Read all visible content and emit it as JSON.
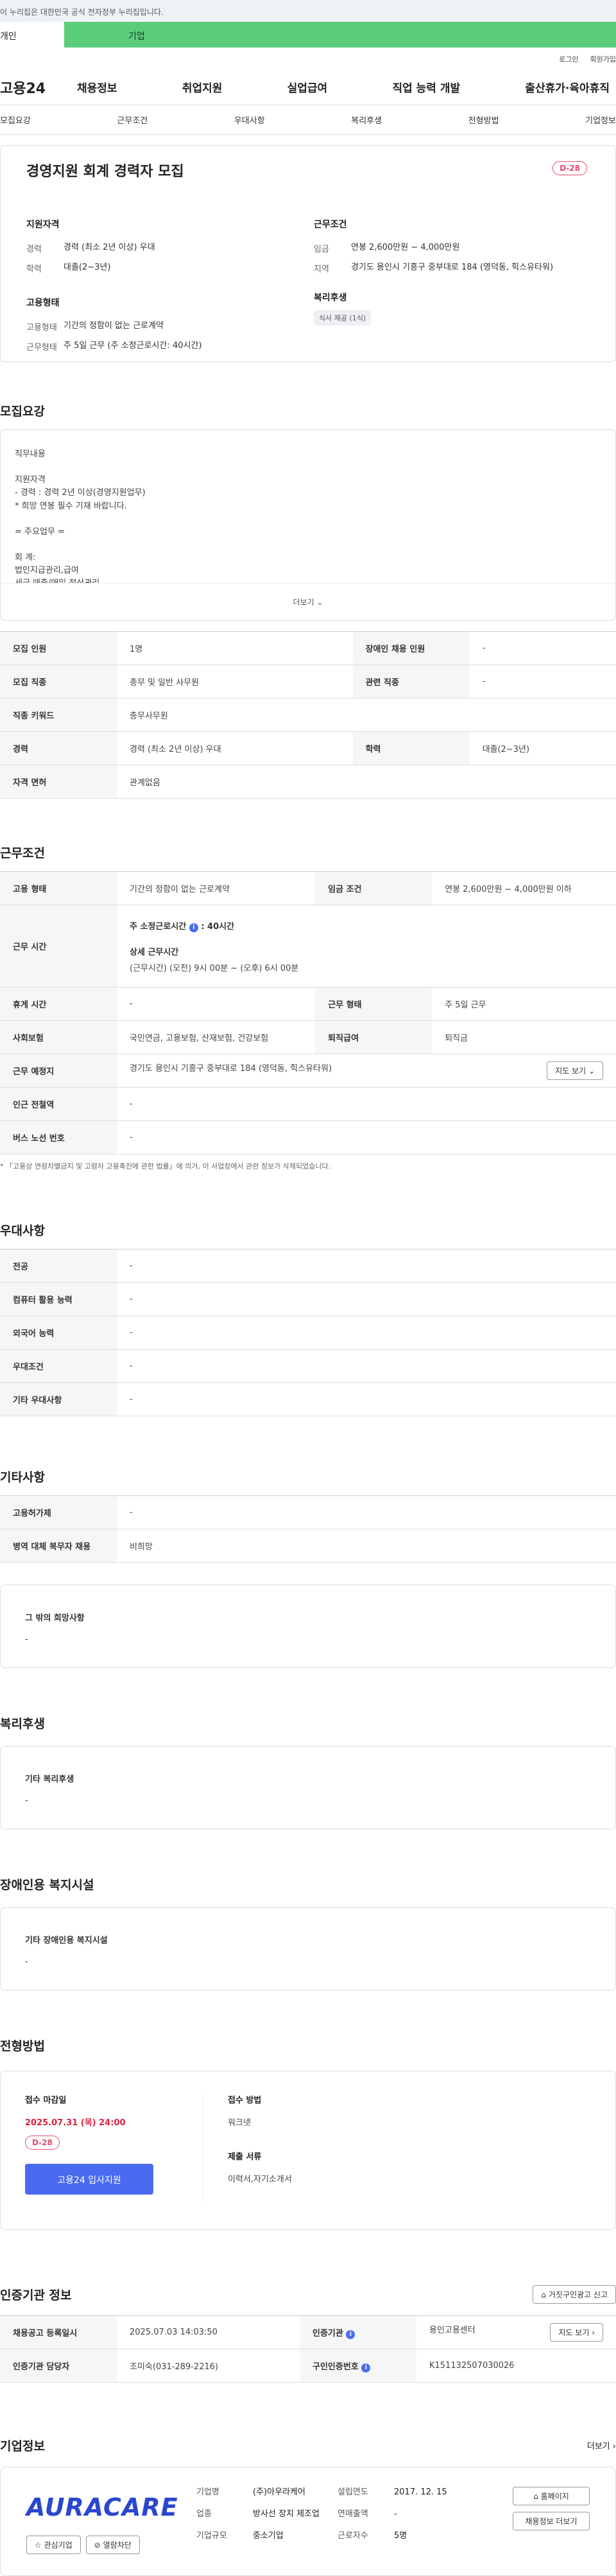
{
  "gov_banner": "이 누리집은 대한민국 공식 전자정부 누리집입니다.",
  "user_tabs": [
    "개인",
    "기업"
  ],
  "util_links": [
    "로그인",
    "회원가입"
  ],
  "logo": "고용24",
  "gnb": [
    "채용정보",
    "취업지원",
    "실업급여",
    "직업 능력 개발",
    "출산휴가·육아휴직"
  ],
  "anchor_tabs": [
    "모집요강",
    "근무조건",
    "우대사항",
    "복리후생",
    "전형방법",
    "기업정보"
  ],
  "summary": {
    "title": "경영지원 회계 경력자 모집",
    "dday": "D-28",
    "qual_title": "지원자격",
    "qual": [
      {
        "k": "경력",
        "v": "경력 (최소 2년 이상) 우대"
      },
      {
        "k": "학력",
        "v": "대졸(2~3년)"
      }
    ],
    "emp_title": "고용형태",
    "emp": [
      {
        "k": "고용형태",
        "v": "기간의 정함이 없는 근로계약"
      },
      {
        "k": "근무형태",
        "v": "주 5일 근무 (주 소정근로시간: 40시간)"
      }
    ],
    "cond_title": "근무조건",
    "cond": [
      {
        "k": "임금",
        "v": "연봉 2,600만원 ~ 4,000만원"
      },
      {
        "k": "지역",
        "v": "경기도 용인시 기흥구 중부대로 184 (영덕동, 힉스유타워)"
      }
    ],
    "welfare_title": "복리후생",
    "welfare_chip": "식사 제공 (1식)"
  },
  "recruit": {
    "title": "모집요강",
    "desc_lines": [
      "직무내용",
      "",
      "지원자격",
      " - 경력 : 경력 2년 이상(경영지원업무)",
      " * 희망 연봉 필수 기재 바랍니다.",
      "",
      "= 주요업무 =",
      "",
      "회   계:",
      "법인지급관리,급여",
      "세금,매출/매입 정산관리"
    ],
    "more": "더보기",
    "rows": [
      [
        {
          "h": "모집 인원",
          "v": "1명"
        },
        {
          "h": "장애인 채용 인원",
          "v": "-"
        }
      ],
      [
        {
          "h": "모집 직종",
          "v": "총무 및 일반 사무원"
        },
        {
          "h": "관련 직종",
          "v": "-"
        }
      ],
      [
        {
          "h": "직종 키워드",
          "v": "총무사무원"
        }
      ],
      [
        {
          "h": "경력",
          "v": "경력 (최소 2년 이상) 우대"
        },
        {
          "h": "학력",
          "v": "대졸(2~3년)"
        }
      ],
      [
        {
          "h": "자격 면허",
          "v": "관계없음"
        }
      ]
    ]
  },
  "work": {
    "title": "근무조건",
    "employ_type_h": "고용 형태",
    "employ_type_v": "기간의 정함이 없는 근로계약",
    "wage_h": "임금 조건",
    "wage_v": "연봉 2,600만원 ~ 4,000만원 이하",
    "hours_h": "근무 시간",
    "hours_line1": "주 소정근로시간",
    "hours_line1b": ": 40시간",
    "hours_sub": "상세 근무시간",
    "hours_detail": "(근무시간) (오전) 9시 00분 ~ (오후) 6시 00분",
    "holiday_h": "휴게 시간",
    "holiday_v": "-",
    "worktype_h": "근무 형태",
    "worktype_v": "주 5일 근무",
    "insurance_h": "사회보험",
    "insurance_v": "국민연금, 고용보험, 산재보험, 건강보험",
    "retire_h": "퇴직급여",
    "retire_v": "퇴직금",
    "place_h": "근무 예정지",
    "place_v": "경기도 용인시 기흥구 중부대로 184 (영덕동, 힉스유타워)",
    "map_btn": "지도 보기",
    "subway_h": "인근 전철역",
    "subway_v": "-",
    "bus_h": "버스 노선 번호",
    "bus_v": "-",
    "note": "* 「고용상 연령차별금지 및 고령자 고용촉진에 관한 법률」에 의거, 이 사업장에서 관련 정보가 삭제되었습니다."
  },
  "prefer": {
    "title": "우대사항",
    "rows": [
      {
        "h": "전공",
        "v": "-"
      },
      {
        "h": "컴퓨터 활용 능력",
        "v": "-"
      },
      {
        "h": "외국어 능력",
        "v": "-"
      },
      {
        "h": "우대조건",
        "v": "-"
      },
      {
        "h": "기타 우대사항",
        "v": "-"
      }
    ]
  },
  "etc": {
    "title": "기타사항",
    "rows": [
      {
        "h": "고용허가제",
        "v": "-"
      },
      {
        "h": "병역 대체 복무자 채용",
        "v": "비희망"
      }
    ],
    "box_title": "그 밖의 희망사항",
    "box_value": "-"
  },
  "welfare": {
    "title": "복리후생",
    "box_title": "기타 복리후생",
    "box_value": "-"
  },
  "disabled": {
    "title": "장애인용 복지시설",
    "box_title": "기타 장애인용 복지시설",
    "box_value": "-"
  },
  "selection": {
    "title": "전형방법",
    "deadline_label": "접수 마감일",
    "deadline": "2025.07.31 (목) 24:00",
    "dday": "D-28",
    "apply_btn": "고용24 입사지원",
    "method_label": "접수 방법",
    "method": "워크넷",
    "docs_label": "제출 서류",
    "docs": "이력서,자기소개서"
  },
  "cert": {
    "title": "인증기관 정보",
    "report_btn": "거짓구인광고 신고",
    "rows": [
      {
        "h1": "채용공고 등록일시",
        "v1": "2025.07.03 14:03:50",
        "h2": "인증기관",
        "v2": "용인고용센터"
      },
      {
        "h1": "인증기관 담당자",
        "v1": "조미숙(031-289-2216)",
        "h2": "구인인증번호",
        "v2": "K151132507030026"
      }
    ],
    "map_btn": "지도 보기"
  },
  "company": {
    "title": "기업정보",
    "more": "더보기",
    "logo_text": "AURACARE",
    "fav_btn": "관심기업",
    "block_btn": "열람차단",
    "name_k": "기업명",
    "name_v": "(주)아우라케어",
    "industry_k": "업종",
    "industry_v": "방사선 장치 제조업",
    "size_k": "기업규모",
    "size_v": "중소기업",
    "found_k": "설립연도",
    "found_v": "2017. 12. 15",
    "sales_k": "연매출액",
    "sales_v": "-",
    "emp_k": "근로자수",
    "emp_v": "5명",
    "home_btn": "홈페이지",
    "more_jobs_btn": "채용정보 더보기"
  }
}
